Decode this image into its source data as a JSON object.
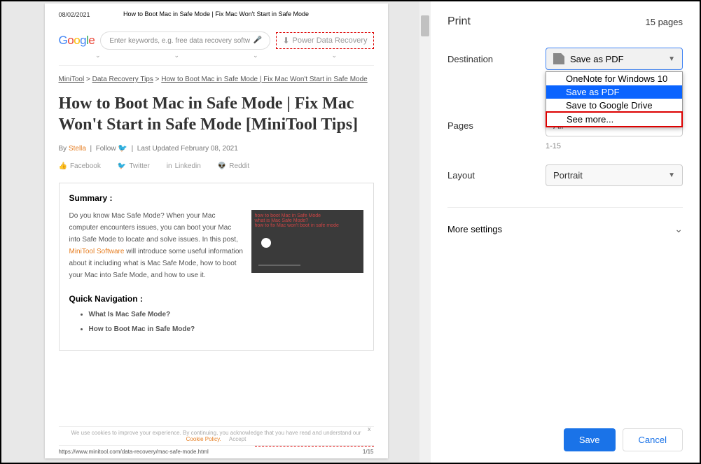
{
  "preview": {
    "date": "08/02/2021",
    "header_title": "How to Boot Mac in Safe Mode | Fix Mac Won't Start in Safe Mode",
    "search_placeholder": "Enter keywords, e.g. free data recovery softw",
    "pdr_button": "Power Data Recovery",
    "breadcrumb": {
      "p1": "MiniTool",
      "p2": "Data Recovery Tips",
      "p3": "How to Boot Mac in Safe Mode | Fix Mac Won't Start in Safe Mode"
    },
    "article_title": "How to Boot Mac in Safe Mode | Fix Mac Won't Start in Safe Mode [MiniTool Tips]",
    "byline_by": "By",
    "byline_author": "Stella",
    "byline_follow": "Follow",
    "byline_updated": "Last Updated February 08, 2021",
    "social": {
      "fb": "Facebook",
      "tw": "Twitter",
      "li": "Linkedin",
      "rd": "Reddit"
    },
    "summary_heading": "Summary :",
    "summary_text1": "Do you know Mac Safe Mode? When your Mac computer encounters issues, you can boot your Mac into Safe Mode to locate and solve issues. In this post, ",
    "summary_link": "MiniTool Software",
    "summary_text2": " will introduce some useful information about it including what is Mac Safe Mode, how to boot your Mac into Safe Mode, and how to use it.",
    "quicknav_heading": "Quick Navigation :",
    "nav_items": [
      "What Is Mac Safe Mode?",
      "How to Boot Mac in Safe Mode?"
    ],
    "cookie_text": "We use cookies to improve your experience. By continuing, you acknowledge that you have read and understand our ",
    "cookie_link": "Cookie Policy.",
    "cookie_accept": "Accept",
    "footer_url": "https://www.minitool.com/data-recovery/mac-safe-mode.html",
    "footer_page": "1/15"
  },
  "print": {
    "title": "Print",
    "page_count": "15 pages",
    "labels": {
      "destination": "Destination",
      "pages": "Pages",
      "layout": "Layout",
      "more": "More settings"
    },
    "destination_value": "Save as PDF",
    "dropdown": [
      "OneNote for Windows 10",
      "Save as PDF",
      "Save to Google Drive",
      "See more..."
    ],
    "pages_value": "All",
    "pages_hint": "1-15",
    "layout_value": "Portrait",
    "save": "Save",
    "cancel": "Cancel"
  }
}
